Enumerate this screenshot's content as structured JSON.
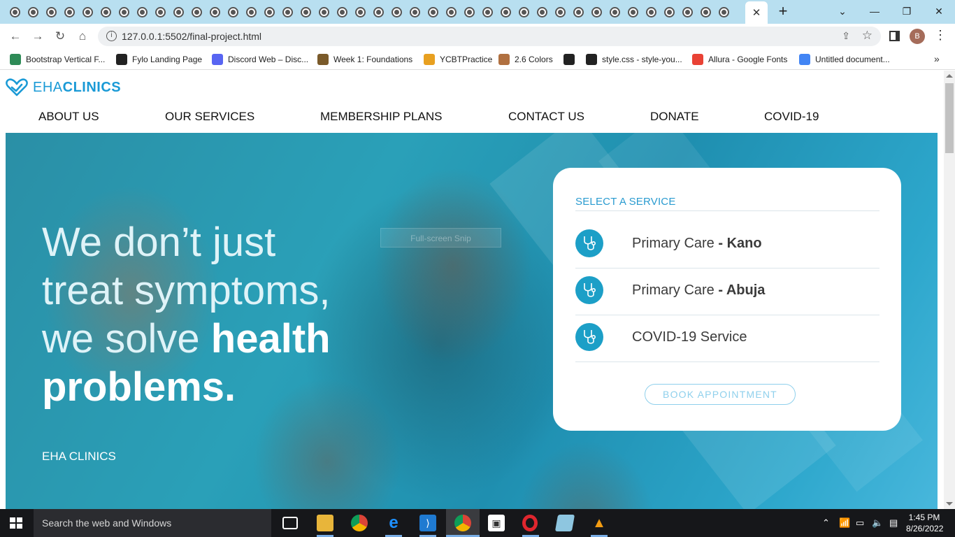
{
  "browser": {
    "tab_count": 40,
    "active_tab_close": "✕",
    "new_tab": "+",
    "window_controls": {
      "dropdown": "⌄",
      "minimize": "—",
      "restore": "❐",
      "close": "✕"
    },
    "url": "127.0.0.1:5502/final-project.html",
    "profile_initial": "B"
  },
  "bookmarks": [
    {
      "label": "Bootstrap Vertical F...",
      "icon": "bootstrap-icon",
      "color": "#2e8b57"
    },
    {
      "label": "Fylo Landing Page",
      "icon": "fylo-icon",
      "color": "#222222"
    },
    {
      "label": "Discord Web – Disc...",
      "icon": "discord-icon",
      "color": "#5865f2"
    },
    {
      "label": "Week 1: Foundations",
      "icon": "tools-icon",
      "color": "#7a5a2a"
    },
    {
      "label": "YCBTPractice",
      "icon": "ycombinator-icon",
      "color": "#e8a020"
    },
    {
      "label": "2.6 Colors",
      "icon": "avatar-icon",
      "color": "#b07040"
    },
    {
      "label": "",
      "icon": "globe-icon",
      "color": "#222222"
    },
    {
      "label": "style.css - style-you...",
      "icon": "codepen-icon",
      "color": "#222222"
    },
    {
      "label": "Allura - Google Fonts",
      "icon": "google-fonts-icon",
      "color": "#e94235"
    },
    {
      "label": "Untitled document...",
      "icon": "google-docs-icon",
      "color": "#4285f4"
    }
  ],
  "bookmarks_more": "»",
  "site": {
    "logo": {
      "light": "EHA",
      "bold": "CLINICS"
    },
    "nav": [
      "ABOUT US",
      "OUR SERVICES",
      "MEMBERSHIP PLANS",
      "CONTACT US",
      "DONATE",
      "COVID-19"
    ],
    "hero": {
      "line1": "We don’t just",
      "line2": "treat symptoms,",
      "line3_plain": "we solve",
      "line3_bold": "health",
      "line4_bold": "problems.",
      "brand": "EHA CLINICS",
      "snip_overlay": "Full-screen Snip"
    },
    "service_card": {
      "title": "SELECT A SERVICE",
      "services": [
        {
          "name": "Primary Care",
          "location": "- Kano"
        },
        {
          "name": "Primary Care",
          "location": "- Abuja"
        },
        {
          "name": "COVID-19 Service",
          "location": ""
        }
      ],
      "cta": "BOOK APPOINTMENT"
    },
    "colors": {
      "brand": "#1a9ad6",
      "accent": "#1c9fc7",
      "cta": "#8fd0ec"
    }
  },
  "taskbar": {
    "search_placeholder": "Search the web and Windows",
    "apps": [
      "task-view-icon",
      "file-explorer-icon",
      "chrome-icon",
      "edge-icon",
      "vscode-icon",
      "chrome-profile-icon",
      "store-icon",
      "opera-icon",
      "notes-icon",
      "vlc-icon"
    ],
    "time": "1:45 PM",
    "date": "8/26/2022"
  }
}
